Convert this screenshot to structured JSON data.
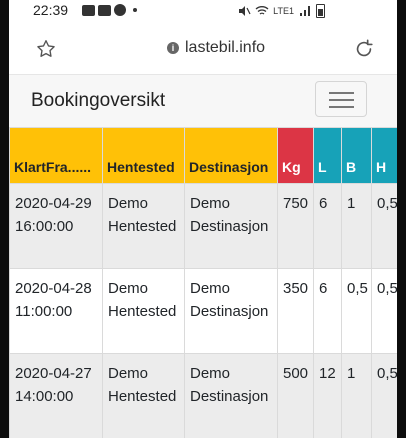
{
  "status_bar": {
    "time": "22:39",
    "network_label": "LTE1"
  },
  "browser": {
    "url": "lastebil.info"
  },
  "navbar": {
    "brand": "Bookingoversikt"
  },
  "colors": {
    "yellow": "#ffc107",
    "red": "#dc3545",
    "teal": "#17a2b8"
  },
  "table": {
    "headers": [
      "KlartFra......",
      "Hentested",
      "Destinasjon",
      "Kg",
      "L",
      "B",
      "H"
    ],
    "rows": [
      {
        "date": "2020-04-29",
        "time": "16:00:00",
        "pickup_1": "Demo",
        "pickup_2": "Hentested",
        "dest_1": "Demo",
        "dest_2": "Destinasjon",
        "kg": "750",
        "l": "6",
        "b": "1",
        "h": "0,5"
      },
      {
        "date": "2020-04-28",
        "time": "11:00:00",
        "pickup_1": "Demo",
        "pickup_2": "Hentested",
        "dest_1": "Demo",
        "dest_2": "Destinasjon",
        "kg": "350",
        "l": "6",
        "b": "0,5",
        "h": "0,5"
      },
      {
        "date": "2020-04-27",
        "time": "14:00:00",
        "pickup_1": "Demo",
        "pickup_2": "Hentested",
        "dest_1": "Demo",
        "dest_2": "Destinasjon",
        "kg": "500",
        "l": "12",
        "b": "1",
        "h": "0,5"
      }
    ]
  }
}
